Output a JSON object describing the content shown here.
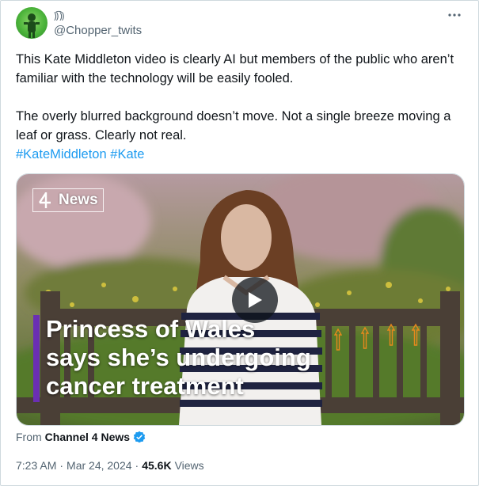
{
  "author": {
    "display_name": "⸩͡⸩",
    "handle": "@Chopper_twits"
  },
  "post": {
    "paragraph_1": "This Kate Middleton video is clearly AI but members of the public who aren’t familiar with the technology will be easily fooled.",
    "paragraph_2": "The overly blurred background doesn’t move. Not a single breeze moving a leaf or grass. Clearly not real.",
    "hashtags": [
      "#KateMiddleton",
      "#Kate"
    ]
  },
  "media": {
    "logo_text": "News",
    "headline_lines": [
      "Princess of Wales",
      "says she’s undergoing",
      "cancer treatment"
    ],
    "overlay_arrow_color": "#e8891c"
  },
  "source": {
    "from_label": "From",
    "org_name": "Channel 4 News"
  },
  "meta": {
    "time": "7:23 AM",
    "separator": "·",
    "date": "Mar 24, 2024",
    "views_count": "45.6K",
    "views_label": "Views"
  },
  "icons": {
    "more": "more-dots-icon",
    "play": "play-icon",
    "verified": "verified-badge-icon",
    "logo": "channel4-logo-icon"
  },
  "colors": {
    "link": "#1d9bf0",
    "verified": "#1d9bf0",
    "headline_accent": "#6a2fb3"
  }
}
